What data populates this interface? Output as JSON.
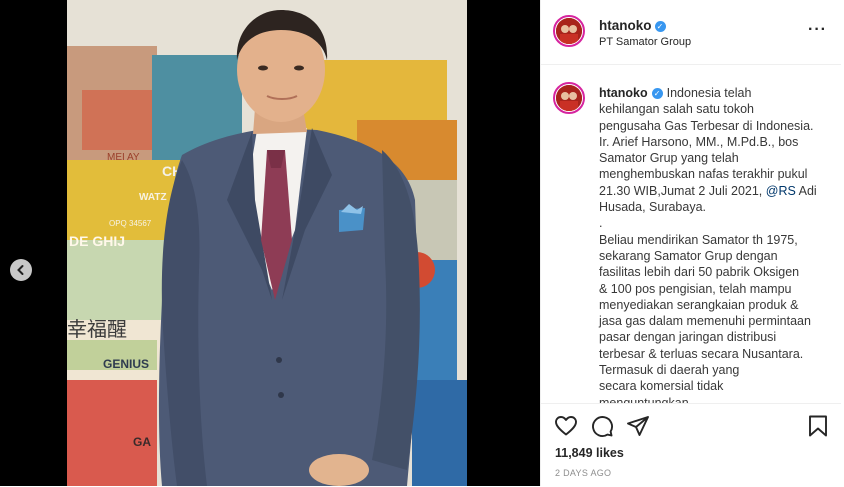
{
  "post": {
    "username": "htanoko",
    "location": "PT Samator Group",
    "caption_lines": [
      "Indonesia telah",
      "kehilangan salah satu tokoh",
      "pengusaha Gas Terbesar di Indonesia.",
      "Ir. Arief Harsono, MM., M.Pd.B., bos",
      "Samator Grup yang telah",
      "menghembuskan nafas terakhir pukul",
      "21.30 WIB,Jumat 2 Juli 2021,",
      "Husada, Surabaya.",
      ".",
      "Beliau mendirikan Samator th 1975,",
      "sekarang Samator Grup dengan",
      "fasilitas lebih dari 50 pabrik Oksigen",
      "& 100 pos pengisian, telah mampu",
      "menyediakan serangkaian produk &",
      "jasa gas dalam memenuhi permintaan",
      "pasar dengan jaringan distribusi",
      "terbesar & terluas secara Nusantara.",
      "Termasuk di daerah yang",
      "secara komersial tidak",
      "menguntungkan."
    ],
    "mention": "@RS",
    "mention_after": " Adi",
    "likes": "11,849 likes",
    "time_ago": "2 DAYS AGO"
  },
  "artwork_text": {
    "chi": "CHI",
    "ghij": "DE GHIJ",
    "genius": "GENIUS",
    "mei_ay": "MEI AY",
    "watz": "WATZ",
    "opq": "OPQ 34567",
    "chinese": "幸福醒",
    "ga": "GA"
  },
  "colors": {
    "accent": "#3897f0",
    "link": "#00376b",
    "suit": "#4d5a76"
  },
  "icons": {
    "prev": "chevron-left-icon",
    "more": "more-options-icon",
    "like": "heart-icon",
    "comment": "comment-icon",
    "share": "paper-plane-icon",
    "save": "bookmark-icon",
    "verified": "verified-badge-icon"
  }
}
